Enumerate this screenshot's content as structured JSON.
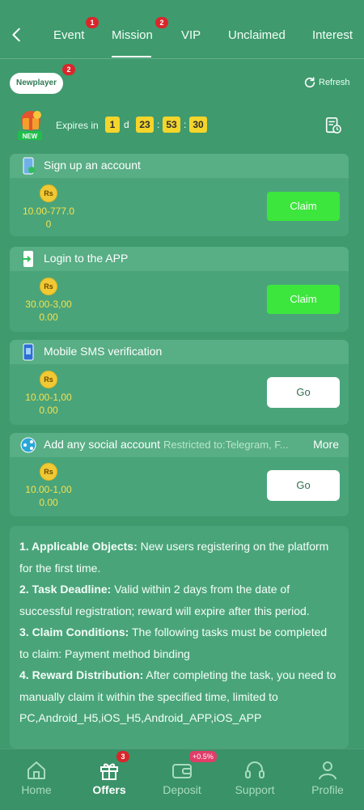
{
  "tabs": [
    {
      "label": "Event",
      "badge": "1"
    },
    {
      "label": "Mission",
      "badge": "2",
      "active": true
    },
    {
      "label": "VIP"
    },
    {
      "label": "Unclaimed"
    },
    {
      "label": "Interest"
    }
  ],
  "filter": {
    "label": "Newplayer",
    "badge": "2"
  },
  "refresh_label": "Refresh",
  "gift_badge": "NEW",
  "expires": {
    "label": "Expires in",
    "days": "1",
    "d_label": "d",
    "hours": "23",
    "minutes": "53",
    "seconds": "30",
    "sep": ":"
  },
  "tasks": [
    {
      "title": "Sign up an account",
      "currency": "Rs",
      "reward_range": "10.00-777.0",
      "reward_range2": "0",
      "action": "Claim"
    },
    {
      "title": "Login to the APP",
      "currency": "Rs",
      "reward_range": "30.00-3,00",
      "reward_range2": "0.00",
      "action": "Claim"
    },
    {
      "title": "Mobile SMS verification",
      "currency": "Rs",
      "reward_range": "10.00-1,00",
      "reward_range2": "0.00",
      "action": "Go"
    },
    {
      "title": "Add any social account",
      "restriction": "Restricted to:Telegram, F...",
      "more": "More",
      "currency": "Rs",
      "reward_range": "10.00-1,00",
      "reward_range2": "0.00",
      "action": "Go"
    }
  ],
  "rules": [
    {
      "heading": "1. Applicable Objects:",
      "text": "New users registering on the platform for the first time."
    },
    {
      "heading": "2. Task Deadline:",
      "text": "Valid within 2 days from the date of successful registration; reward will expire after this period."
    },
    {
      "heading": "3. Claim Conditions:",
      "text": "The following tasks must be completed to claim: Payment method binding"
    },
    {
      "heading": "4. Reward Distribution:",
      "text": "After completing the task, you need to manually claim it within the specified time, limited to PC,Android_H5,iOS_H5,Android_APP,iOS_APP"
    }
  ],
  "nav": [
    {
      "label": "Home",
      "icon": "home-icon"
    },
    {
      "label": "Offers",
      "icon": "gift-icon",
      "badge": "3",
      "active": true
    },
    {
      "label": "Deposit",
      "icon": "wallet-icon",
      "badge": "+0.5%"
    },
    {
      "label": "Support",
      "icon": "headset-icon"
    },
    {
      "label": "Profile",
      "icon": "person-icon"
    }
  ],
  "colors": {
    "background": "#3f9a6e",
    "card": "#4aa47a",
    "claim_button": "#3ce63c",
    "badge_red": "#d9262b",
    "timer_yellow": "#f4d52b",
    "reward_text": "#f7e14a"
  }
}
